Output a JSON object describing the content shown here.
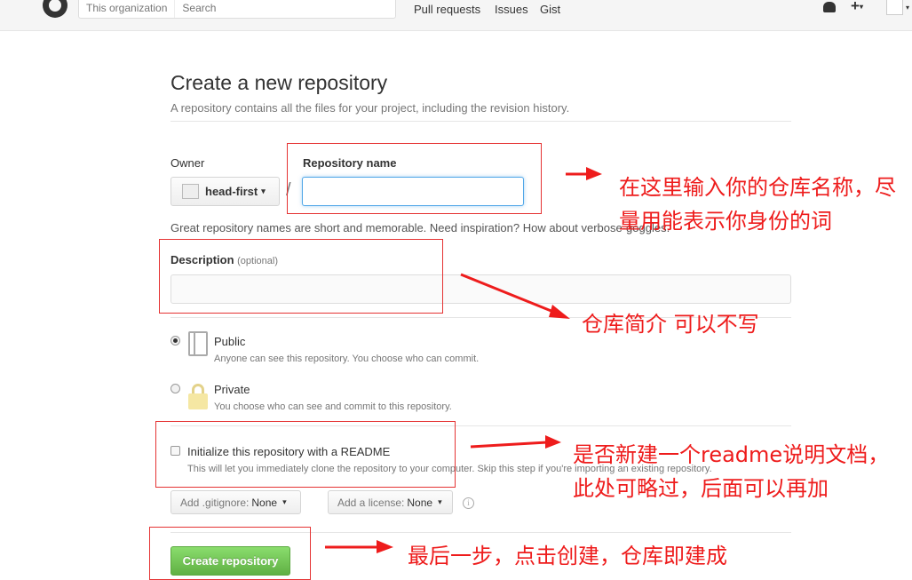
{
  "topbar": {
    "search_scope": "This organization",
    "search_placeholder": "Search",
    "nav": [
      "Pull requests",
      "Issues",
      "Gist"
    ],
    "plus": "+"
  },
  "page": {
    "title": "Create a new repository",
    "subtitle": "A repository contains all the files for your project, including the revision history."
  },
  "form": {
    "owner_label": "Owner",
    "owner_value": "head-first",
    "slash": "/",
    "repo_name_label": "Repository name",
    "repo_name_value": "",
    "name_hint": "Great repository names are short and memorable. Need inspiration? How about verbose-goggles.",
    "description_label": "Description",
    "description_optional": "(optional)",
    "description_value": "",
    "public_label": "Public",
    "public_note": "Anyone can see this repository. You choose who can commit.",
    "private_label": "Private",
    "private_note": "You choose who can see and commit to this repository.",
    "visibility_selected": "Public",
    "readme_label": "Initialize this repository with a README",
    "readme_note": "This will let you immediately clone the repository to your computer. Skip this step if you're importing an existing repository.",
    "readme_checked": false,
    "gitignore_label": "Add .gitignore:",
    "gitignore_value": "None",
    "license_label": "Add a license:",
    "license_value": "None",
    "info_glyph": "i",
    "create_button": "Create repository"
  },
  "annotations": {
    "repo_name": "在这里输入你的仓库名称，尽量用能表示你身份的词",
    "description": "仓库简介 可以不写",
    "readme": "是否新建一个readme说明文档，此处可略过，后面可以再加",
    "create": "最后一步，点击创建，仓库即建成"
  },
  "colors": {
    "annotation_red": "#ee1c1c",
    "create_button_green": "#60b044",
    "focus_blue": "#51a7e8"
  }
}
